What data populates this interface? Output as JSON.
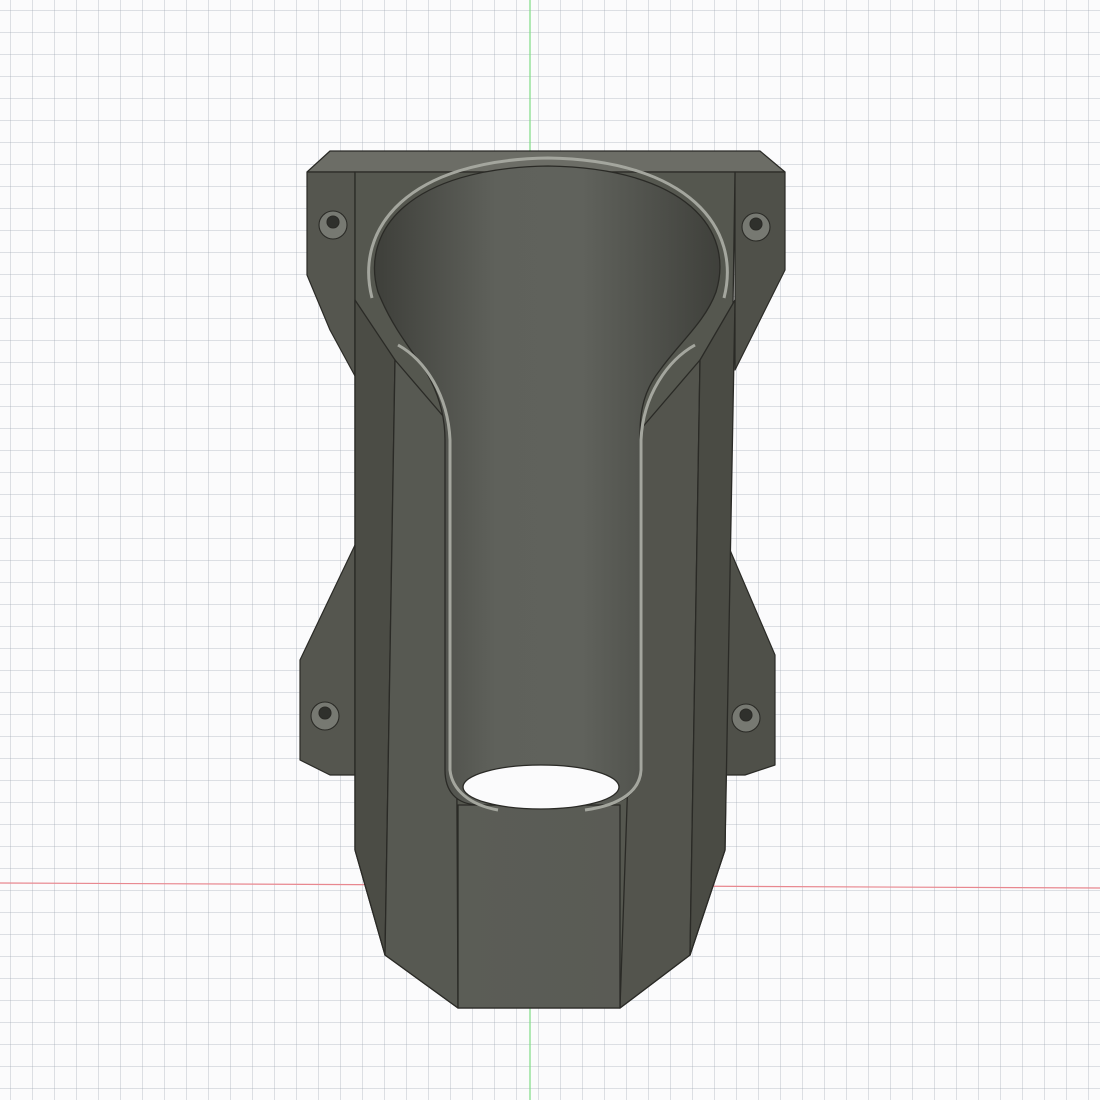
{
  "viewport": {
    "grid": true,
    "background": "#fbfbfc",
    "grid_color": "#c8ccd3",
    "axis_colors": {
      "green_axis": "#7fdc84",
      "red_axis": "#e8878f"
    }
  },
  "model": {
    "colors": {
      "body_light": "#666963",
      "body_mid": "#55574f",
      "body_dark": "#45463f",
      "edge": "#2a2a26",
      "highlight": "#9a9c94"
    }
  }
}
